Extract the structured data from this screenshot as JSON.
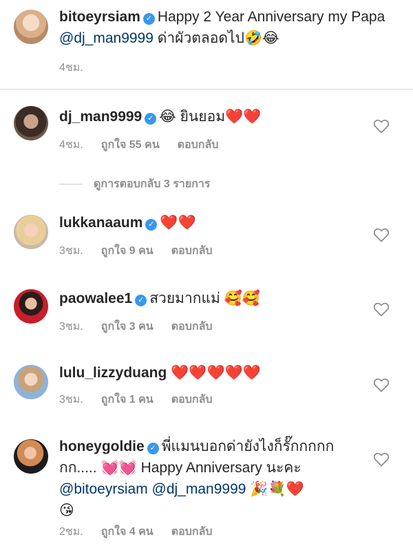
{
  "caption": {
    "username": "bitoeyrsiam",
    "text_before": "Happy 2 Year Anniversary my Papa ",
    "mention": "@dj_man9999",
    "text_after": " ด่าผัวตลอดไป",
    "emojis": "🤣😂",
    "time": "4ชม."
  },
  "view_replies": "ดูการตอบกลับ 3 รายการ",
  "comments": [
    {
      "username": "dj_man9999",
      "verified": true,
      "emoji_lead": "😂",
      "text": " ยินยอม",
      "emoji_tail": "❤️❤️",
      "time": "4ชม.",
      "likes": "ถูกใจ 55 คน",
      "reply": "ตอบกลับ"
    },
    {
      "username": "lukkanaaum",
      "verified": true,
      "text": "",
      "emoji_tail": "❤️❤️",
      "time": "3ชม.",
      "likes": "ถูกใจ 9 คน",
      "reply": "ตอบกลับ"
    },
    {
      "username": "paowalee1",
      "verified": true,
      "text": "สวยมากแม่ ",
      "emoji_tail": "🥰🥰",
      "time": "3ชม.",
      "likes": "ถูกใจ 3 คน",
      "reply": "ตอบกลับ"
    },
    {
      "username": "lulu_lizzyduang",
      "verified": false,
      "text": "",
      "emoji_tail": "❤️❤️❤️❤️❤️",
      "time": "3ชม.",
      "likes": "ถูกใจ 1 คน",
      "reply": "ตอบกลับ"
    },
    {
      "username": "honeygoldie",
      "verified": true,
      "text_1": "พี่แมนบอกด่ายังไงก็รั๊กกกกก",
      "text_2": "กก..... ",
      "hearts": "💓💓",
      "text_3": " Happy Anniversary นะคะ ",
      "mention_1": "@bitoeyrsiam",
      "mention_2": "@dj_man9999",
      "emojis_end": "🎉💐❤️",
      "kiss": "😘",
      "time": "2ชม.",
      "likes": "ถูกใจ 4 คน",
      "reply": "ตอบกลับ"
    }
  ],
  "colors": {
    "text": "#262626",
    "meta": "#8e8e8e",
    "mention": "#00376b",
    "verified": "#3897f0",
    "divider": "#dbdbdb"
  },
  "icons": {
    "verified": "verified-badge-icon",
    "like": "heart-outline-icon"
  }
}
